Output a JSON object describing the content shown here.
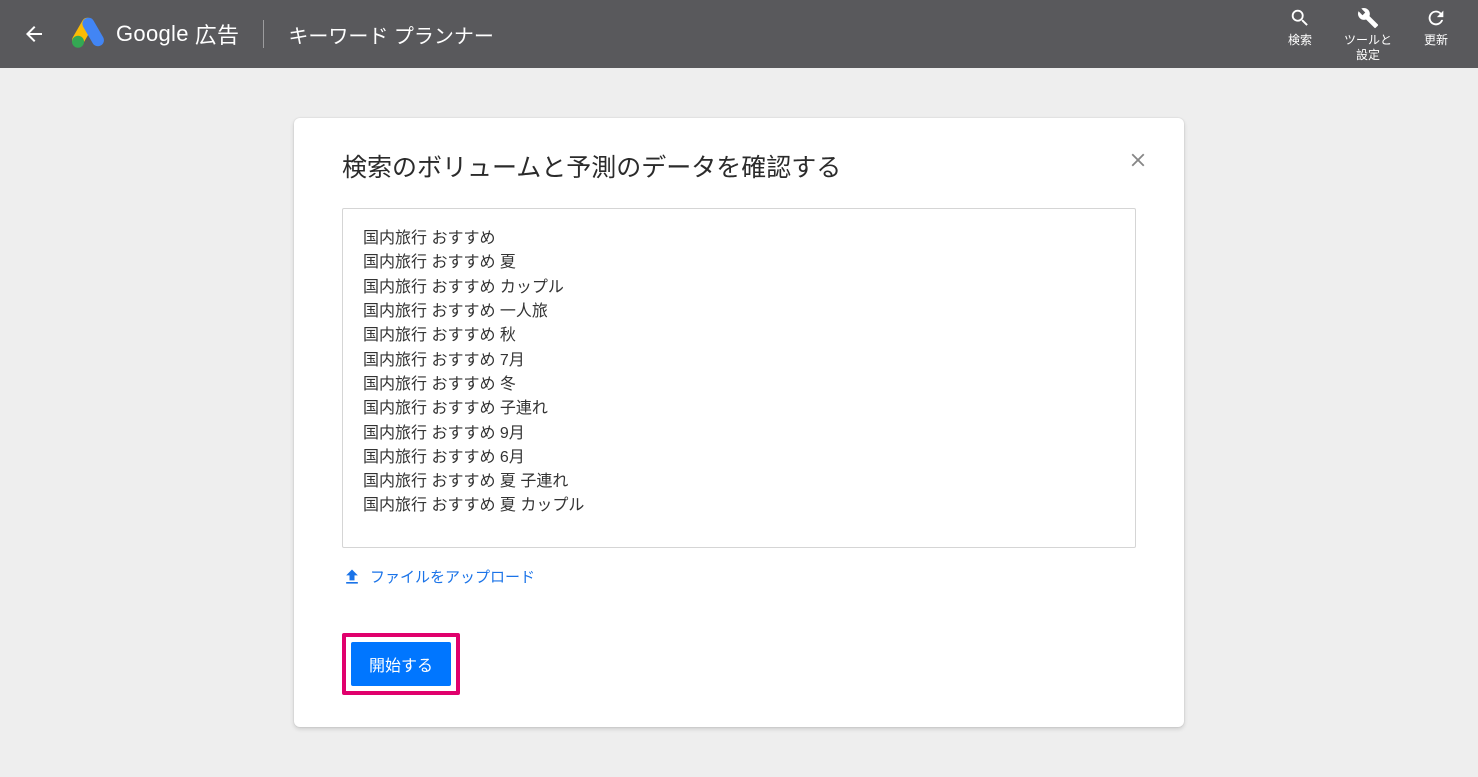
{
  "header": {
    "brand_google": "Google",
    "brand_ads": "広告",
    "section": "キーワード プランナー",
    "tools": {
      "search": "検索",
      "tools_settings": "ツールと\n設定",
      "refresh": "更新"
    }
  },
  "card": {
    "title": "検索のボリュームと予測のデータを確認する",
    "keywords": [
      "国内旅行 おすすめ",
      "国内旅行 おすすめ 夏",
      "国内旅行 おすすめ カップル",
      "国内旅行 おすすめ 一人旅",
      "国内旅行 おすすめ 秋",
      "国内旅行 おすすめ 7月",
      "国内旅行 おすすめ 冬",
      "国内旅行 おすすめ 子連れ",
      "国内旅行 おすすめ 9月",
      "国内旅行 おすすめ 6月",
      "国内旅行 おすすめ 夏 子連れ",
      "国内旅行 おすすめ 夏 カップル"
    ],
    "upload_label": "ファイルをアップロード",
    "start_label": "開始する"
  },
  "icons": {
    "back": "back-arrow",
    "close": "close-x",
    "search": "magnifier",
    "tools": "wrench",
    "refresh": "refresh-circle",
    "upload": "upload"
  },
  "colors": {
    "appbar_bg": "#59595c",
    "link_blue": "#1a73e8",
    "primary_button": "#0076ff",
    "highlight_border": "#e0006c"
  }
}
